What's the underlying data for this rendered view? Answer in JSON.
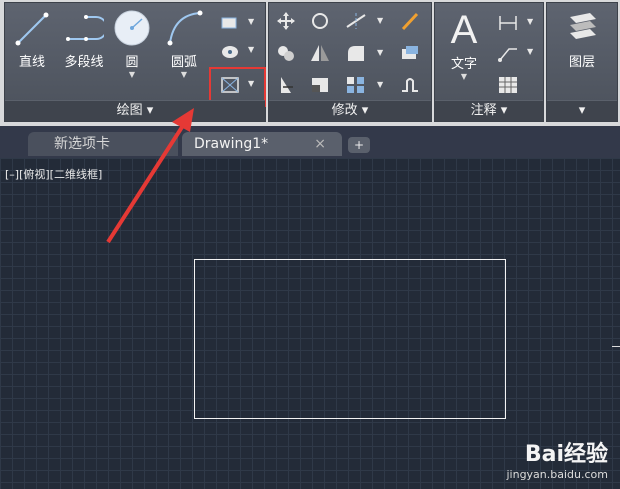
{
  "ribbon": {
    "draw_panel": {
      "title": "绘图",
      "buttons": [
        {
          "label": "直线",
          "icon": "line-icon"
        },
        {
          "label": "多段线",
          "icon": "polyline-icon"
        },
        {
          "label": "圆",
          "icon": "circle-icon"
        },
        {
          "label": "圆弧",
          "icon": "arc-icon"
        }
      ]
    },
    "modify_panel": {
      "title": "修改"
    },
    "annotation_panel": {
      "title": "注释",
      "text_label": "文字"
    },
    "layer_panel": {
      "title": "图层"
    }
  },
  "tabs": [
    {
      "label": "新选项卡"
    },
    {
      "label": "Drawing1*"
    }
  ],
  "viewport": {
    "label": "[–][俯视][二维线框]"
  },
  "watermark": {
    "brand": "Bai经验",
    "url": "jingyan.baidu.com"
  },
  "colors": {
    "highlight": "#e53935",
    "canvas": "#232b38",
    "ribbon": "#4f5560"
  }
}
